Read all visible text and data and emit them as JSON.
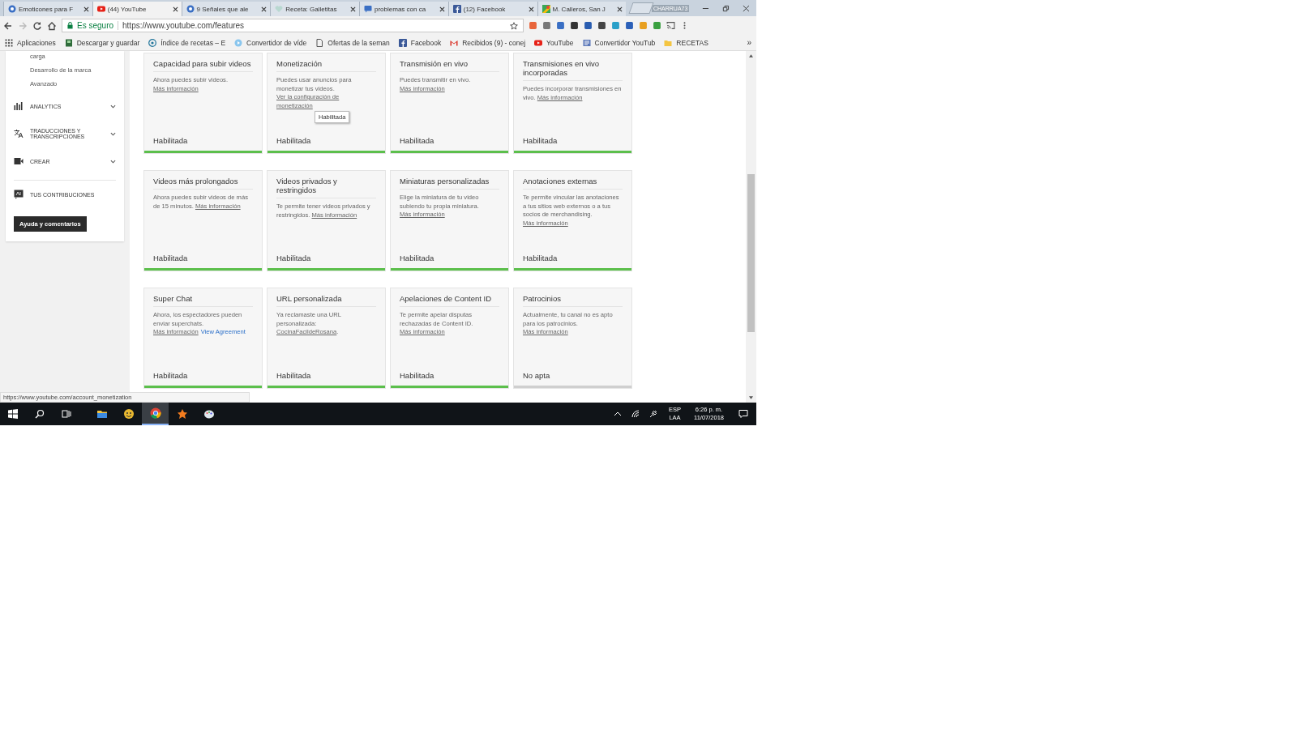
{
  "tabs": [
    {
      "label": "Emoticones para F",
      "selected": false
    },
    {
      "label": "(44) YouTube",
      "selected": true
    },
    {
      "label": "9 Señales que ale",
      "selected": false
    },
    {
      "label": "Receta: Galletitas",
      "selected": false
    },
    {
      "label": "problemas con ca",
      "selected": false
    },
    {
      "label": "(12) Facebook",
      "selected": false
    },
    {
      "label": "M. Calleros, San J",
      "selected": false
    }
  ],
  "profile": "CHARRUA73",
  "address": {
    "secure_label": "Es seguro",
    "url": "https://www.youtube.com/features"
  },
  "bookmarks": [
    "Aplicaciones",
    "Descargar y guardar",
    "Índice de recetas – E",
    "Convertidor de víde",
    "Ofertas de la seman",
    "Facebook",
    "Recibidos (9) - conej",
    "YouTube",
    "Convertidor YouTub",
    "RECETAS"
  ],
  "bookmarks_more": "»",
  "sidebar": {
    "subitems": [
      "carga",
      "Desarrollo de la marca",
      "Avanzado"
    ],
    "sections": [
      {
        "label": "ANALYTICS",
        "expandable": true
      },
      {
        "label": "TRADUCCIONES Y TRANSCRIPCIONES",
        "expandable": true
      },
      {
        "label": "CREAR",
        "expandable": true
      },
      {
        "label": "TUS CONTRIBUCIONES",
        "expandable": false
      }
    ],
    "help_button": "Ayuda y comentarios"
  },
  "features": [
    {
      "title": "Capacidad para subir videos",
      "description": [
        {
          "text": "Ahora puedes subir videos. ",
          "kind": "plain"
        },
        {
          "text": "Más información",
          "kind": "link"
        }
      ],
      "status": "Habilitada",
      "enabled": true
    },
    {
      "title": "Monetización",
      "description": [
        {
          "text": "Puedes usar anuncios para monetizar tus videos. ",
          "kind": "plain"
        },
        {
          "text": "Ver la configuración de monetización",
          "kind": "link"
        }
      ],
      "status": "Habilitada",
      "enabled": true,
      "tooltip": "Habilitada"
    },
    {
      "title": "Transmisión en vivo",
      "description": [
        {
          "text": "Puedes transmitir en vivo. ",
          "kind": "plain"
        },
        {
          "text": "Más información",
          "kind": "link"
        }
      ],
      "status": "Habilitada",
      "enabled": true
    },
    {
      "title": "Transmisiones en vivo incorporadas",
      "description": [
        {
          "text": "Puedes incorporar transmisiones en vivo. ",
          "kind": "plain"
        },
        {
          "text": "Más información",
          "kind": "link"
        }
      ],
      "status": "Habilitada",
      "enabled": true
    },
    {
      "title": "Videos más prolongados",
      "description": [
        {
          "text": "Ahora puedes subir videos de más de 15 minutos. ",
          "kind": "plain"
        },
        {
          "text": "Más información",
          "kind": "link"
        }
      ],
      "status": "Habilitada",
      "enabled": true
    },
    {
      "title": "Videos privados y restringidos",
      "description": [
        {
          "text": "Te permite tener videos privados y restringidos. ",
          "kind": "plain"
        },
        {
          "text": "Más información",
          "kind": "link"
        }
      ],
      "status": "Habilitada",
      "enabled": true
    },
    {
      "title": "Miniaturas personalizadas",
      "description": [
        {
          "text": "Elige la miniatura de tu video subiendo tu propia miniatura. ",
          "kind": "plain"
        },
        {
          "text": "Más información",
          "kind": "link"
        }
      ],
      "status": "Habilitada",
      "enabled": true
    },
    {
      "title": "Anotaciones externas",
      "description": [
        {
          "text": "Te permite vincular las anotaciones a tus sitios web externos o a tus socios de merchandising. ",
          "kind": "plain"
        },
        {
          "text": "Más información",
          "kind": "link"
        }
      ],
      "status": "Habilitada",
      "enabled": true
    },
    {
      "title": "Super Chat",
      "description": [
        {
          "text": "Ahora, los espectadores pueden enviar superchats. ",
          "kind": "plain"
        },
        {
          "text": "Más información",
          "kind": "link"
        },
        {
          "text": "View Agreement",
          "kind": "blue-link"
        }
      ],
      "status": "Habilitada",
      "enabled": true
    },
    {
      "title": "URL personalizada",
      "description": [
        {
          "text": "Ya reclamaste una URL personalizada: ",
          "kind": "plain"
        },
        {
          "text": "CocinaFacildeRosana",
          "kind": "link"
        },
        {
          "text": ".",
          "kind": "plain"
        }
      ],
      "status": "Habilitada",
      "enabled": true
    },
    {
      "title": "Apelaciones de Content ID",
      "description": [
        {
          "text": "Te permite apelar disputas rechazadas de Content ID. ",
          "kind": "plain"
        },
        {
          "text": "Más información",
          "kind": "link"
        }
      ],
      "status": "Habilitada",
      "enabled": true
    },
    {
      "title": "Patrocinios",
      "description": [
        {
          "text": "Actualmente, tu canal no es apto para los patrocinios. ",
          "kind": "plain"
        },
        {
          "text": "Más información",
          "kind": "link"
        }
      ],
      "status": "No apta",
      "enabled": false
    }
  ],
  "status_url": "https://www.youtube.com/account_monetization",
  "taskbar": {
    "apps": [
      {
        "active": false
      },
      {
        "active": false
      },
      {
        "active": true
      },
      {
        "active": false
      },
      {
        "active": false
      }
    ],
    "language": "ESP",
    "layout": "LAA",
    "time": "6:26 p. m.",
    "date": "11/07/2018"
  }
}
